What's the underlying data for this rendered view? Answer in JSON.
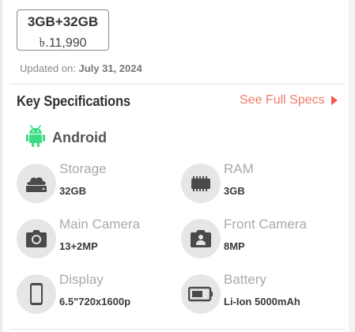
{
  "variant": {
    "name": "3GB+32GB",
    "price": "৳.11,990"
  },
  "updated": {
    "label": "Updated on:",
    "date": "July 31, 2024"
  },
  "key_specs": {
    "title": "Key Specifications",
    "see_full": "See Full Specs"
  },
  "os": {
    "label": "Android",
    "icon": "android-icon"
  },
  "specs": [
    {
      "title": "Storage",
      "value": "32GB",
      "icon": "storage-icon"
    },
    {
      "title": "RAM",
      "value": "3GB",
      "icon": "ram-icon"
    },
    {
      "title": "Main Camera",
      "value": "13+2MP",
      "icon": "camera-icon"
    },
    {
      "title": "Front Camera",
      "value": "8MP",
      "icon": "front-camera-icon"
    },
    {
      "title": "Display",
      "value": "6.5\"720x1600p",
      "icon": "phone-icon"
    },
    {
      "title": "Battery",
      "value": "Li-Ion 5000mAh",
      "icon": "battery-icon"
    }
  ],
  "colors": {
    "accent": "#ef7a6b",
    "android_green": "#3ddc84"
  }
}
